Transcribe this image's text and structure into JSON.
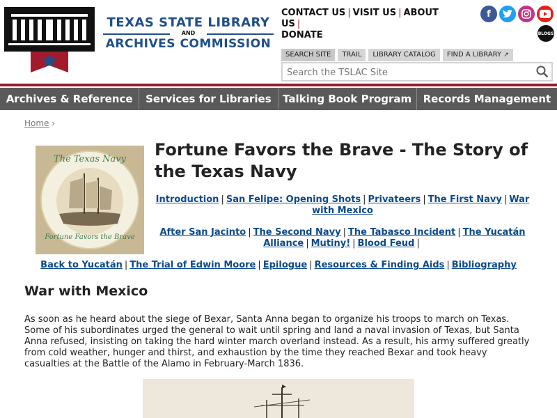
{
  "header": {
    "title_line1": "TEXAS STATE LIBRARY",
    "title_and": "AND",
    "title_line2": "ARCHIVES COMMISSION",
    "top_links": [
      "CONTACT US",
      "VISIT US",
      "ABOUT US",
      "DONATE"
    ],
    "social": {
      "facebook_color": "#3b5998",
      "twitter_color": "#1da1f2",
      "instagram_color": "#c13584",
      "youtube_color": "#e62117",
      "blogs_label": "BLOGS"
    }
  },
  "search": {
    "tabs": [
      "SEARCH SITE",
      "TRAIL",
      "LIBRARY CATALOG",
      "FIND A LIBRARY"
    ],
    "placeholder": "Search the TSLAC Site"
  },
  "nav": {
    "items": [
      "Archives & Reference",
      "Services for Libraries",
      "Talking Book Program",
      "Records Management"
    ]
  },
  "breadcrumb": {
    "home": "Home",
    "sep": "›"
  },
  "page": {
    "title": "Fortune Favors the Brave - The Story of the Texas Navy",
    "links_row1": [
      "Introduction",
      "San Felipe: Opening Shots",
      "Privateers",
      "The First Navy",
      "War with Mexico"
    ],
    "links_row2": [
      "After San Jacinto",
      "The Second Navy",
      "The Tabasco Incident",
      "The Yucatán Alliance",
      "Mutiny!",
      "Blood Feud"
    ],
    "links_row3": [
      "Back to Yucatán",
      "The Trial of  Edwin Moore",
      "Epilogue",
      "Resources & Finding Aids",
      "Bibliography"
    ],
    "image_top_text": "The Texas Navy",
    "image_bottom_text": "Fortune Favors the Brave",
    "section_heading": "War with Mexico",
    "body": "As soon as he heard about the siege of Bexar, Santa Anna began to organize his troops to march on Texas. Some of his subordinates urged the general to wait until spring and land a naval invasion of Texas, but Santa Anna refused, insisting on taking the hard winter march overland instead. As a result, his army suffered greatly from cold weather, hunger and thirst, and exhaustion by the time they reached Bexar and took heavy casualties at the Battle of the Alamo in February-March 1836."
  },
  "colors": {
    "brand_blue": "#1f4f8b",
    "brand_red": "#9b1b2e",
    "nav_gray": "#5a5a5a",
    "link": "#0b4a8a"
  }
}
